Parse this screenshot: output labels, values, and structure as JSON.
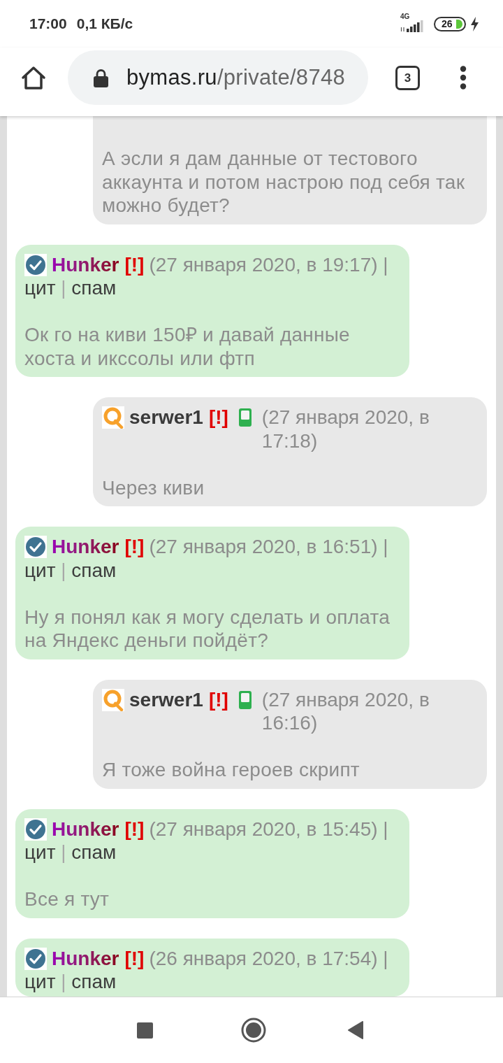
{
  "status_bar": {
    "time": "17:00",
    "net_speed": "0,1 КБ/с",
    "network_type": "4G",
    "battery": "26"
  },
  "browser": {
    "domain": "bymas.ru",
    "path": "/private/8748",
    "tab_count": "3"
  },
  "messages": [
    {
      "kind": "outgoing",
      "body": "А эсли я дам данные от тестового аккаунта и потом настрою под себя так можно будет?"
    },
    {
      "kind": "incoming",
      "author": "Hunker",
      "flag": "[!]",
      "mobile": false,
      "date": "(27 января 2020, в 19:17) |",
      "actions": [
        "цит",
        "спам"
      ],
      "action_divider": "|",
      "body": "Ок го на киви 150₽ и давай данные хоста и икссолы или фтп"
    },
    {
      "kind": "outgoing",
      "author": "serwer1",
      "flag": "[!]",
      "mobile": true,
      "date": "(27 января 2020, в 17:18)",
      "body": "Через киви"
    },
    {
      "kind": "incoming",
      "author": "Hunker",
      "flag": "[!]",
      "mobile": false,
      "date": "(27 января 2020, в 16:51) |",
      "actions": [
        "цит",
        "спам"
      ],
      "action_divider": "|",
      "body": "Ну я понял как я могу сделать и оплата на Яндекс деньги пойдёт?"
    },
    {
      "kind": "outgoing",
      "author": "serwer1",
      "flag": "[!]",
      "mobile": true,
      "date": "(27 января 2020, в 16:16)",
      "body": "Я тоже война героев скрипт"
    },
    {
      "kind": "incoming",
      "author": "Hunker",
      "flag": "[!]",
      "mobile": false,
      "date": "(27 января 2020, в 15:45) |",
      "actions": [
        "цит",
        "спам"
      ],
      "action_divider": "|",
      "body": "Все я тут"
    },
    {
      "kind": "incoming",
      "author": "Hunker",
      "flag": "[!]",
      "mobile": false,
      "date": "(26 января 2020, в 17:54) |",
      "actions": [
        "цит",
        "спам"
      ],
      "action_divider": "|"
    }
  ]
}
